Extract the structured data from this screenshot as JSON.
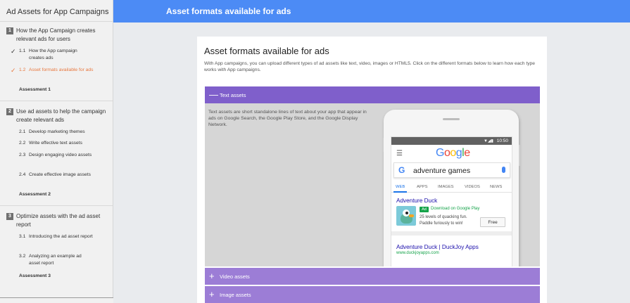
{
  "sidebar": {
    "title": "Ad Assets for App Campaigns",
    "modules": [
      {
        "number": "1",
        "title": "How the App Campaign creates relevant ads for users",
        "lessons": [
          {
            "number": "1.1",
            "label": "How the App campaign creates ads",
            "status": "check"
          },
          {
            "number": "1.2",
            "label": "Asset formats available for ads",
            "status": "active"
          }
        ],
        "assessment": "Assessment 1"
      },
      {
        "number": "2",
        "title": "Use ad assets to help the campaign create relevant ads",
        "lessons": [
          {
            "number": "2.1",
            "label": "Develop marketing themes"
          },
          {
            "number": "2.2",
            "label": "Write effective text assets"
          },
          {
            "number": "2.3",
            "label": "Design engaging video assets"
          },
          {
            "number": "2.4",
            "label": "Create effective image assets"
          }
        ],
        "assessment": "Assessment 2"
      },
      {
        "number": "3",
        "title": "Optimize assets with the ad asset report",
        "lessons": [
          {
            "number": "3.1",
            "label": "Introducing the ad asset report"
          },
          {
            "number": "3.2",
            "label": "Analyzing an example ad asset report"
          }
        ],
        "assessment": "Assessment 3"
      }
    ]
  },
  "header": {
    "title": "Asset formats available for ads"
  },
  "card": {
    "title": "Asset formats available for ads",
    "intro": "With App campaigns, you can upload different types of ad assets like text, video, images or HTML5. Click on the different formats below to learn how each type works with App campaigns.",
    "accordion": [
      {
        "label": "Text assets",
        "open": true,
        "icon": "minus-icon"
      },
      {
        "label": "Video assets",
        "open": false,
        "icon": "plus-icon"
      },
      {
        "label": "Image assets",
        "open": false,
        "icon": "plus-icon"
      }
    ],
    "text_assets_body": "Text assets are short standalone lines of text about your app that appear in ads on Google Search, the Google Play Store, and the Google Display Network."
  },
  "phone": {
    "time": "10:50",
    "logo": "Google",
    "search_query": "adventure games",
    "tabs": [
      "WEB",
      "APPS",
      "IMAGES",
      "VIDEOS",
      "NEWS"
    ],
    "active_tab": "WEB",
    "result1": {
      "title": "Adventure Duck",
      "ad_badge": "Ad",
      "ad_line": "Download on Google Play",
      "desc_line1": "25 levels of quacking fun.",
      "desc_line2": "Paddle furiously to win!",
      "button": "Free"
    },
    "result2": {
      "title": "Adventure Duck | DuckJoy Apps",
      "url": "www.duckjoyapps.com"
    }
  },
  "colors": {
    "header_blue": "#4c8bf5",
    "accordion_open": "#7f5fcb",
    "accordion_closed": "#9c7dd6",
    "active_lesson": "#e8773e"
  }
}
